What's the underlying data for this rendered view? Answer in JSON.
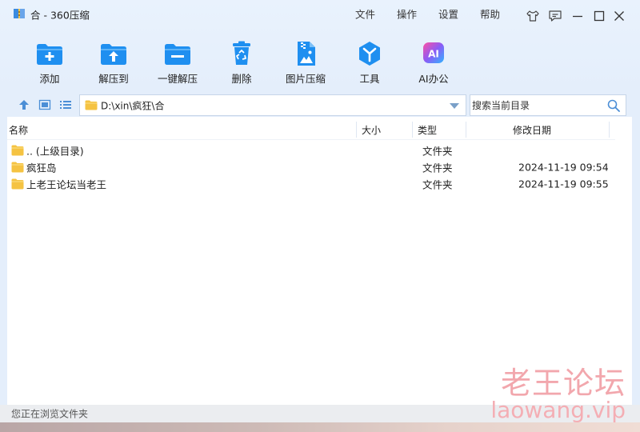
{
  "window": {
    "title": "合 - 360压缩"
  },
  "menu": {
    "file": "文件",
    "operate": "操作",
    "settings": "设置",
    "help": "帮助"
  },
  "toolbar": [
    {
      "label": "添加",
      "icon": "folder-add-icon"
    },
    {
      "label": "解压到",
      "icon": "folder-extract-icon"
    },
    {
      "label": "一键解压",
      "icon": "one-click-extract-icon"
    },
    {
      "label": "删除",
      "icon": "recycle-bin-icon"
    },
    {
      "label": "图片压缩",
      "icon": "image-compress-icon"
    },
    {
      "label": "工具",
      "icon": "tools-icon"
    },
    {
      "label": "AI办公",
      "icon": "ai-office-icon"
    }
  ],
  "address": {
    "path": "D:\\xin\\疯狂\\合"
  },
  "search": {
    "placeholder": "搜索当前目录"
  },
  "columns": {
    "name": "名称",
    "size": "大小",
    "type": "类型",
    "modified": "修改日期"
  },
  "files": [
    {
      "name": ".. (上级目录)",
      "size": "",
      "type": "文件夹",
      "modified": ""
    },
    {
      "name": "疯狂岛",
      "size": "",
      "type": "文件夹",
      "modified": "2024-11-19 09:54"
    },
    {
      "name": "上老王论坛当老王",
      "size": "",
      "type": "文件夹",
      "modified": "2024-11-19 09:55"
    }
  ],
  "status": {
    "text": "您正在浏览文件夹"
  },
  "watermark": {
    "cn": "老王论坛",
    "en": "laowang.vip"
  },
  "colors": {
    "accent": "#1e8fe6",
    "folder": "#f5c342",
    "toolbar_bg": "#e4eefb"
  }
}
